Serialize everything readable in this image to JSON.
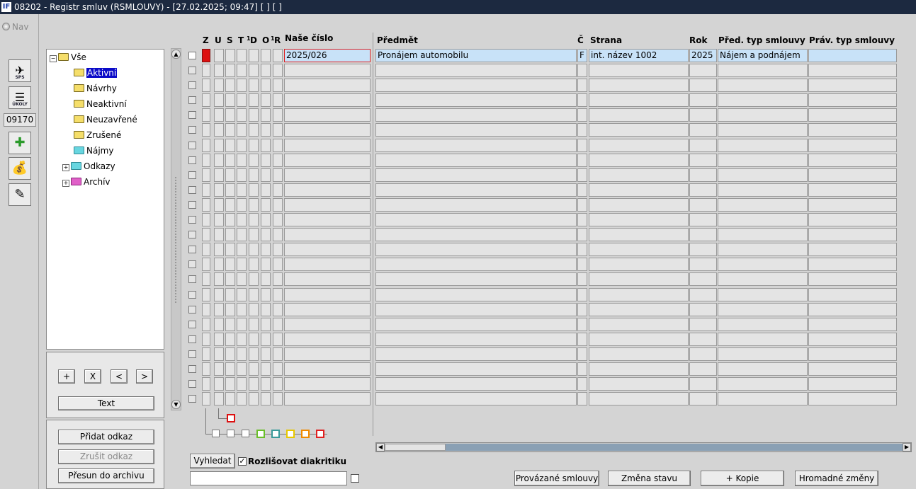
{
  "window": {
    "title": "08202 - Registr smluv (RSMLOUVY) - [27.02.2025; 09:47]  [ ]  [ ]",
    "logo": "IF"
  },
  "nav_label": "Nav",
  "left_toolbar": {
    "sps_label": "SPS",
    "ukoly_label": "ÚKOLY",
    "counter": "09170"
  },
  "tree": {
    "root": "Vše",
    "items": [
      "Aktivní",
      "Návrhy",
      "Neaktivní",
      "Neuzavřené",
      "Zrušené",
      "Nájmy",
      "Odkazy",
      "Archív"
    ],
    "selected": "Aktivní"
  },
  "tree_controls": {
    "add": "+",
    "remove": "X",
    "prev": "<",
    "next": ">",
    "text": "Text"
  },
  "link_controls": {
    "add_link": "Přidat odkaz",
    "remove_link": "Zrušit odkaz",
    "move_archive": "Přesun do archivu"
  },
  "columns": {
    "z": "Z",
    "u": "U",
    "s": "S",
    "t": "T",
    "d_prefix": "1",
    "d": "D",
    "o": "O",
    "r_prefix": "1",
    "r": "R",
    "our_number": "Naše číslo",
    "subject": "Předmět",
    "c": "Č",
    "party": "Strana",
    "year": "Rok",
    "pred_type": "Před. typ smlouvy",
    "prav_type": "Práv. typ smlouvy"
  },
  "rows": [
    {
      "our_number": "2025/026",
      "subject": "Pronájem automobilu",
      "c": "F",
      "party": "int. název 1002",
      "year": "2025",
      "pred_type": "Nájem a podnájem",
      "prav_type": ""
    }
  ],
  "empty_row_count": 23,
  "search": {
    "button": "Vyhledat",
    "diacritics_label": "Rozlišovat diakritiku",
    "diacritics_checked": true,
    "value": ""
  },
  "bottom_buttons": {
    "linked": "Provázané smlouvy",
    "change_state": "Změna stavu",
    "copy": "+ Kopie",
    "bulk": "Hromadné změny"
  },
  "legend_colors": [
    "#ffffff",
    "#ffffff",
    "#ffffff",
    "#6abf2a",
    "#3a9a9a",
    "#e8c800",
    "#f08a00",
    "#e02020"
  ]
}
